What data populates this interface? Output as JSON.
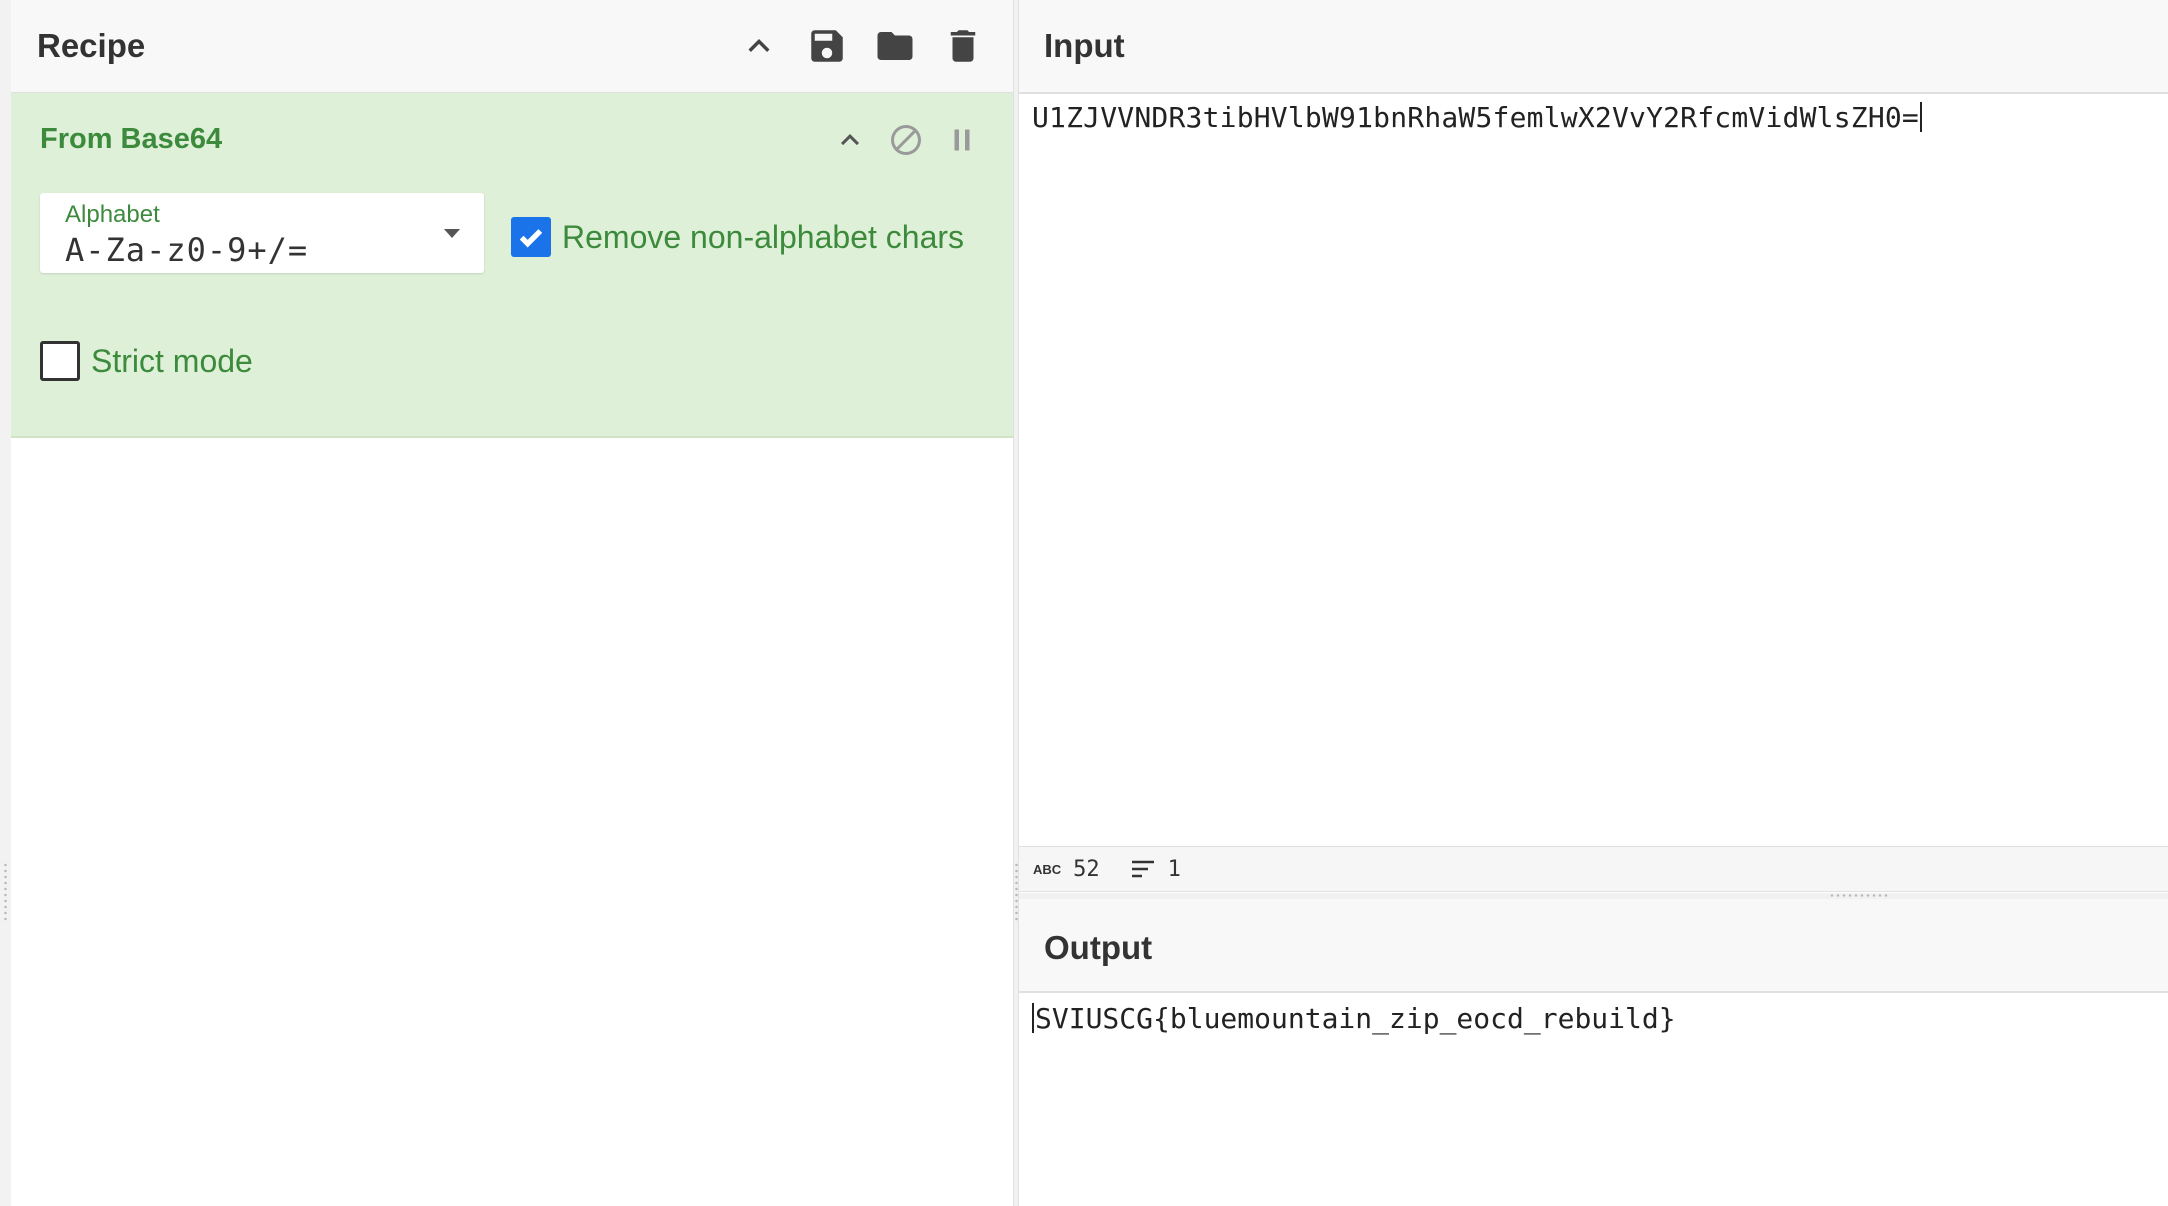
{
  "recipe": {
    "title": "Recipe",
    "operation": {
      "name": "From Base64",
      "alphabet_label": "Alphabet",
      "alphabet_value": "A-Za-z0-9+/=",
      "remove_non_alphabet": {
        "label": "Remove non-alphabet chars",
        "checked": true
      },
      "strict_mode": {
        "label": "Strict mode",
        "checked": false
      }
    },
    "icons": [
      "chevron-up-icon",
      "save-icon",
      "folder-icon",
      "trash-icon"
    ],
    "op_icons": [
      "chevron-up-icon",
      "disable-icon",
      "pause-icon"
    ]
  },
  "input": {
    "title": "Input",
    "text": "U1ZJVVNDR3tibHVlbW91bnRhaW5femlwX2VvY2RfcmVidWlsZH0=",
    "status": {
      "chars_label": "ABC",
      "chars": "52",
      "lines": "1"
    }
  },
  "output": {
    "title": "Output",
    "text": "SVIUSCG{bluemountain_zip_eocd_rebuild}"
  },
  "colors": {
    "operation_bg": "#dff0d8",
    "operation_text": "#3c8a3c",
    "checkbox": "#1a73e8"
  }
}
